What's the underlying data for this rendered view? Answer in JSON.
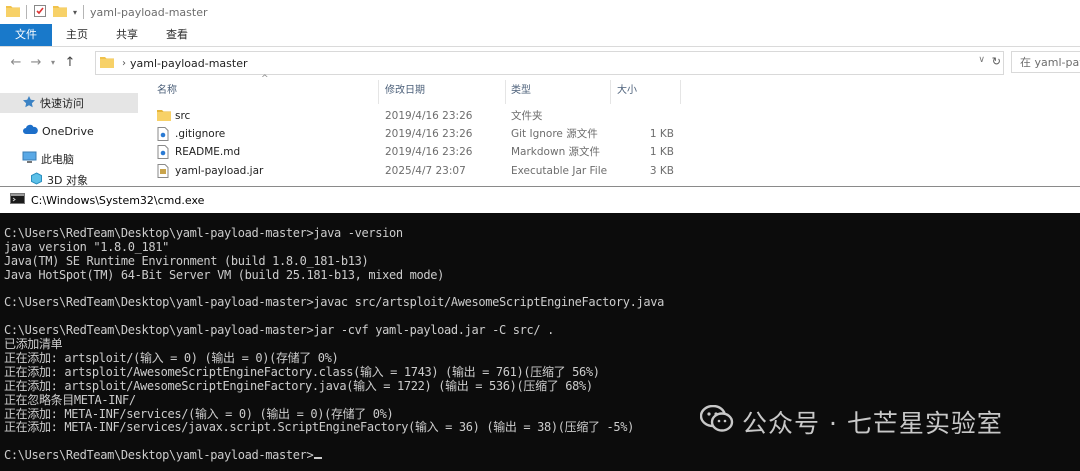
{
  "explorer": {
    "title": "yaml-payload-master",
    "ribbon_tabs": [
      {
        "label": "文件",
        "active": true
      },
      {
        "label": "主页",
        "active": false
      },
      {
        "label": "共享",
        "active": false
      },
      {
        "label": "查看",
        "active": false
      }
    ],
    "address": {
      "crumb": "yaml-payload-master"
    },
    "search": {
      "placeholder": "在 yaml-payload-master 中搜索"
    },
    "sidebar": [
      {
        "label": "快速访问",
        "icon": "star-icon",
        "selected": true
      },
      {
        "label": "OneDrive",
        "icon": "cloud-icon",
        "selected": false
      },
      {
        "label": "此电脑",
        "icon": "computer-icon",
        "selected": false
      },
      {
        "label": "3D 对象",
        "icon": "cube-icon",
        "selected": false
      }
    ],
    "columns": {
      "name": "名称",
      "date": "修改日期",
      "type": "类型",
      "size": "大小"
    },
    "files": [
      {
        "name": "src",
        "date": "2019/4/16 23:26",
        "type": "文件夹",
        "size": "",
        "icon": "folder-icon"
      },
      {
        "name": ".gitignore",
        "date": "2019/4/16 23:26",
        "type": "Git Ignore 源文件",
        "size": "1 KB",
        "icon": "file-icon"
      },
      {
        "name": "README.md",
        "date": "2019/4/16 23:26",
        "type": "Markdown 源文件",
        "size": "1 KB",
        "icon": "file-icon"
      },
      {
        "name": "yaml-payload.jar",
        "date": "2025/4/7 23:07",
        "type": "Executable Jar File",
        "size": "3 KB",
        "icon": "jar-icon"
      }
    ]
  },
  "cmd": {
    "title": "C:\\Windows\\System32\\cmd.exe",
    "lines": [
      "C:\\Users\\RedTeam\\Desktop\\yaml-payload-master>java -version",
      "java version \"1.8.0_181\"",
      "Java(TM) SE Runtime Environment (build 1.8.0_181-b13)",
      "Java HotSpot(TM) 64-Bit Server VM (build 25.181-b13, mixed mode)",
      "",
      "C:\\Users\\RedTeam\\Desktop\\yaml-payload-master>javac src/artsploit/AwesomeScriptEngineFactory.java",
      "",
      "C:\\Users\\RedTeam\\Desktop\\yaml-payload-master>jar -cvf yaml-payload.jar -C src/ .",
      "已添加清单",
      "正在添加: artsploit/(输入 = 0) (输出 = 0)(存储了 0%)",
      "正在添加: artsploit/AwesomeScriptEngineFactory.class(输入 = 1743) (输出 = 761)(压缩了 56%)",
      "正在添加: artsploit/AwesomeScriptEngineFactory.java(输入 = 1722) (输出 = 536)(压缩了 68%)",
      "正在忽略条目META-INF/",
      "正在添加: META-INF/services/(输入 = 0) (输出 = 0)(存储了 0%)",
      "正在添加: META-INF/services/javax.script.ScriptEngineFactory(输入 = 36) (输出 = 38)(压缩了 -5%)",
      "",
      "C:\\Users\\RedTeam\\Desktop\\yaml-payload-master>"
    ]
  },
  "watermark": {
    "text": "公众号 · 七芒星实验室"
  },
  "colors": {
    "ribbon_active": "#1979ca",
    "console_bg": "#0c0c0c",
    "console_fg": "#cccccc"
  }
}
